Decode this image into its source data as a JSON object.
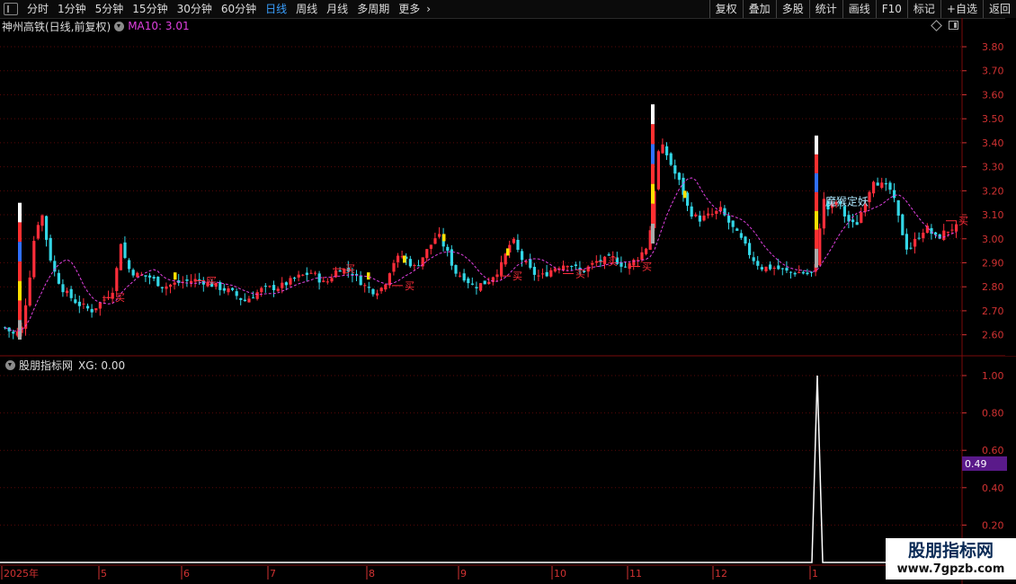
{
  "toolbar": {
    "periods": [
      "分时",
      "1分钟",
      "5分钟",
      "15分钟",
      "30分钟",
      "60分钟",
      "日线",
      "周线",
      "月线",
      "多周期",
      "更多"
    ],
    "active_period": "日线",
    "right_buttons": [
      "复权",
      "叠加",
      "多股",
      "统计",
      "画线",
      "F10",
      "标记",
      "+自选",
      "返回"
    ]
  },
  "main_title": {
    "stock": "神州高铁(日线,前复权)",
    "ma_label": "MA10: 3.01"
  },
  "sub_title": {
    "name": "股朋指标网",
    "xg": "XG: 0.00"
  },
  "price_axis": {
    "ticks": [
      "3.80",
      "3.70",
      "3.60",
      "3.50",
      "3.40",
      "3.30",
      "3.20",
      "3.10",
      "3.00",
      "2.90",
      "2.80",
      "2.70",
      "2.60"
    ]
  },
  "indicator_axis": {
    "ticks": [
      "1.00",
      "0.80",
      "0.60",
      "0.40",
      "0.20"
    ],
    "cursor_value": "0.49"
  },
  "date_axis": {
    "labels": [
      "2025年",
      "5",
      "6",
      "7",
      "8",
      "9",
      "10",
      "11",
      "12",
      "1"
    ]
  },
  "annotations": {
    "buy_marks": [
      "买",
      "买",
      "买",
      "买",
      "买",
      "买",
      "买",
      "买",
      "买"
    ],
    "signal_text": "魔猴定妖"
  },
  "colors": {
    "up": "#ff2d3a",
    "down": "#33d6e6",
    "ma": "#e040e0",
    "grid": "#7a0a0a",
    "axis_text": "#d23232",
    "cursor_bg": "#5a1a8a"
  },
  "watermark": {
    "main": "股朋指标网",
    "url": "www.7gpzb.com"
  }
}
